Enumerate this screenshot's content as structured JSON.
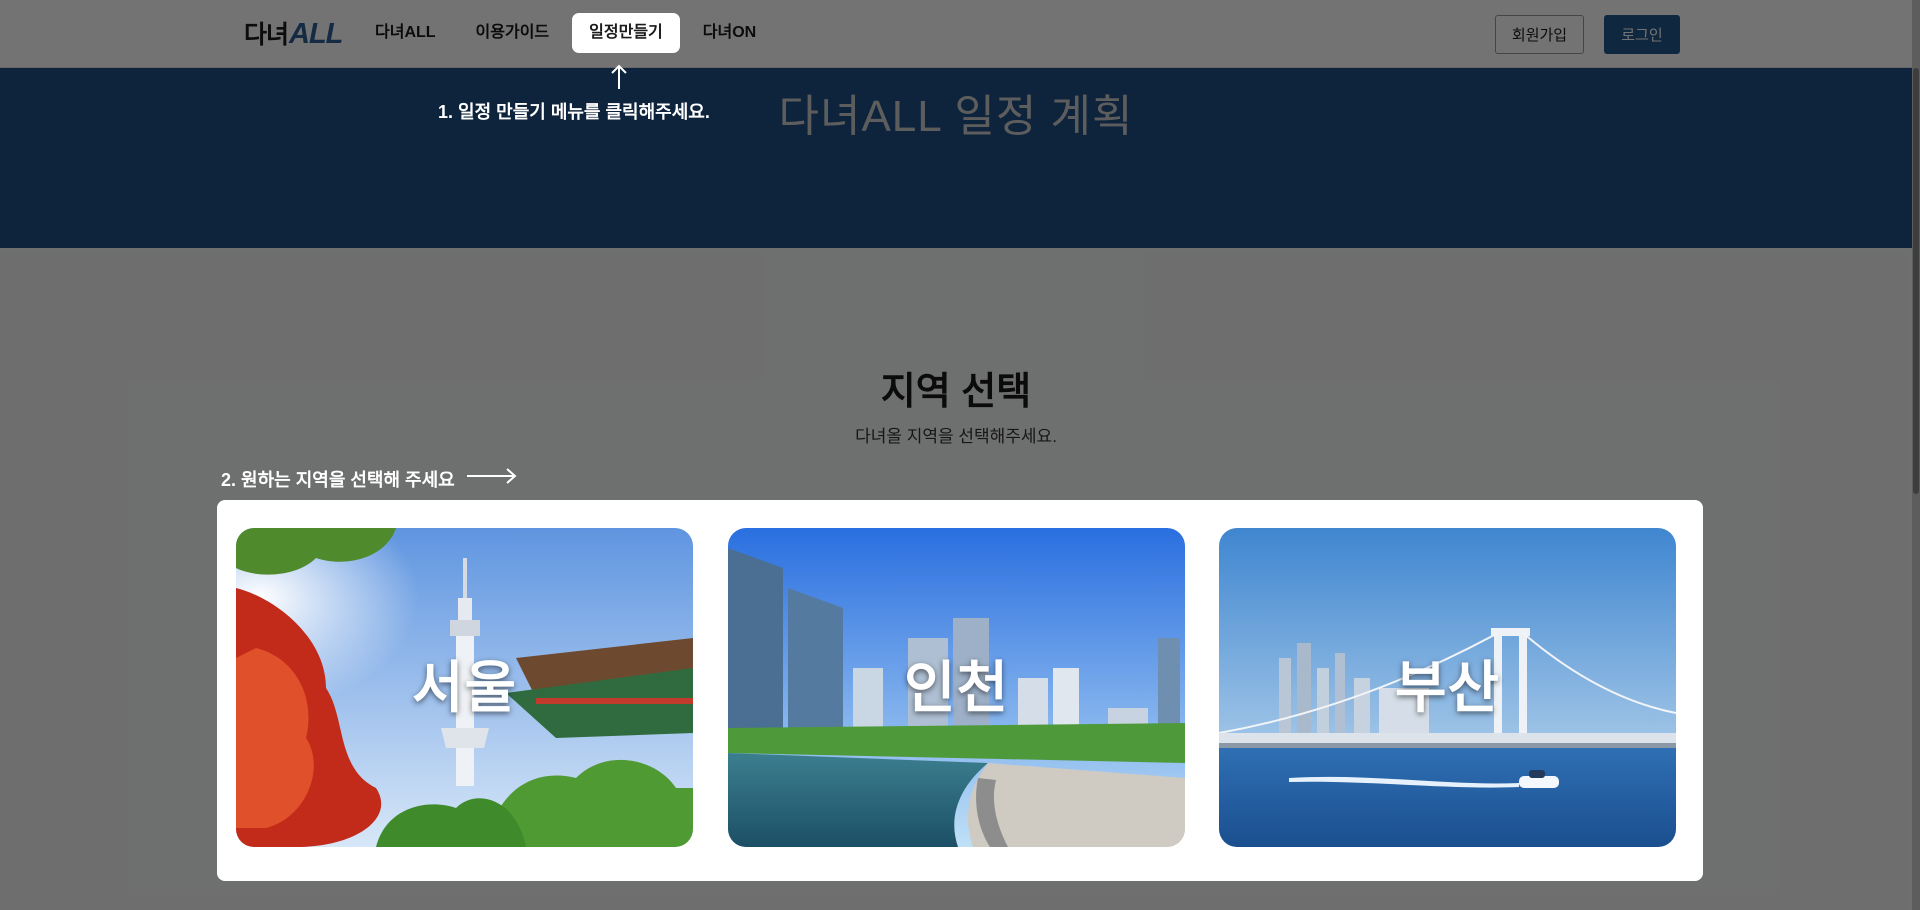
{
  "header": {
    "logo_korean": "다녀",
    "logo_latin": "ALL",
    "nav": [
      "다녀ALL",
      "이용가이드",
      "일정만들기",
      "다녀ON"
    ],
    "signup_label": "회원가입",
    "login_label": "로그인"
  },
  "hero": {
    "title": "다녀ALL 일정 계획"
  },
  "regions": {
    "title": "지역 선택",
    "subtitle": "다녀올 지역을 선택해주세요.",
    "cards": [
      "서울",
      "인천",
      "부산"
    ]
  },
  "guide": {
    "step1": "1. 일정 만들기 메뉴를 클릭해주세요.",
    "step2": "2. 원하는 지역을 선택해 주세요"
  },
  "colors": {
    "primary": "#24578f",
    "hero_bg": "#1f4f85"
  }
}
